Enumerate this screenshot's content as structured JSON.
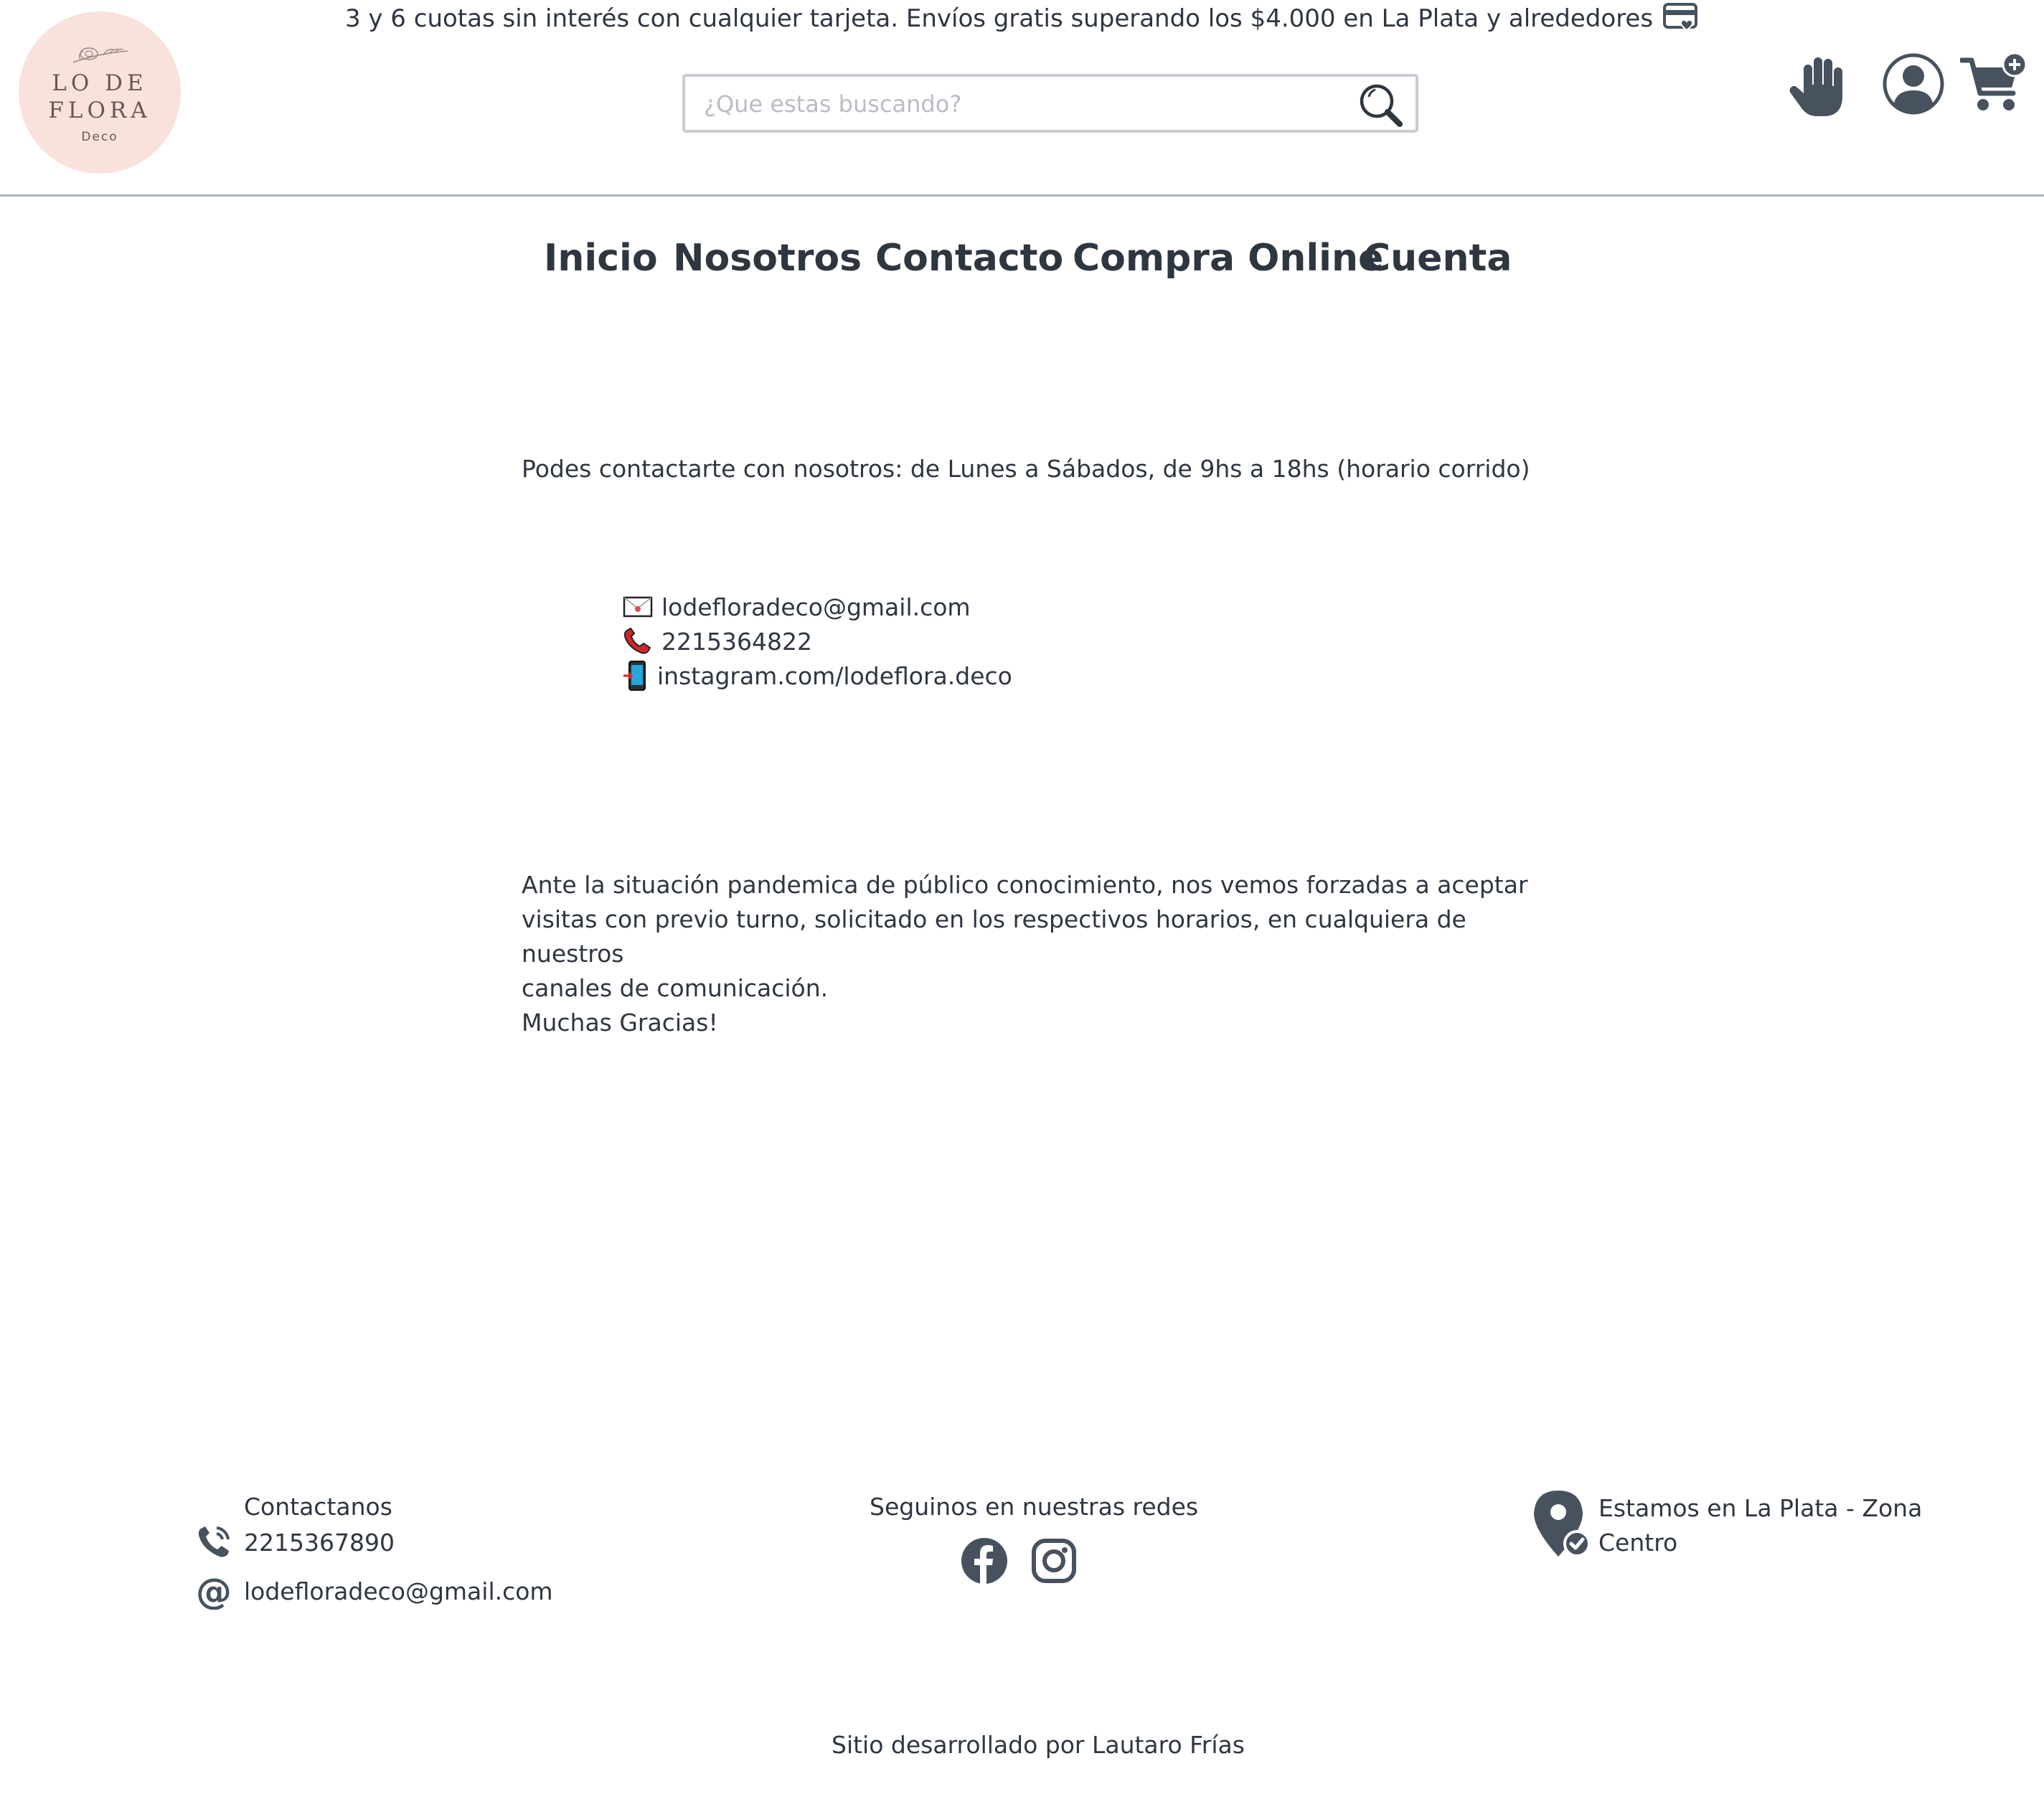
{
  "promo": {
    "text": "3 y 6 cuotas sin interés con cualquier tarjeta. Envíos gratis superando los $4.000 en La Plata y alrededores",
    "icon": "credit-card-heart-icon"
  },
  "logo": {
    "line1": "LO DE",
    "line2": "FLORA",
    "line3": "Deco",
    "background": "#f9e2dc"
  },
  "search": {
    "placeholder": "¿Que estas buscando?",
    "value": "",
    "icon": "search-icon"
  },
  "header_icons": [
    "hand-icon",
    "user-icon",
    "cart-add-icon"
  ],
  "nav": {
    "items": [
      "Inicio",
      "Nosotros",
      "Contacto",
      "Compra Online",
      "Cuenta"
    ]
  },
  "main": {
    "hours": "Podes contactarte con nosotros: de Lunes a Sábados, de 9hs a 18hs (horario corrido)",
    "contacts": [
      {
        "icon": "envelope-icon",
        "text": "lodefloradeco@gmail.com"
      },
      {
        "icon": "telephone-icon",
        "text": "2215364822"
      },
      {
        "icon": "mobile-phone-icon",
        "text": "instagram.com/lodeflora.deco"
      }
    ],
    "notice_lines": [
      "Ante la situación pandemica de público conocimiento, nos vemos forzadas a aceptar",
      "visitas con previo turno, solicitado en los respectivos horarios, en cualquiera de nuestros",
      "canales de comunicación.",
      "Muchas Gracias!"
    ]
  },
  "footer": {
    "contact_title": "Contactanos",
    "phone": "2215367890",
    "email": "lodefloradeco@gmail.com",
    "social_title": "Seguinos en nuestras redes",
    "social_icons": [
      "facebook-icon",
      "instagram-icon"
    ],
    "location_lines": [
      "Estamos en La Plata - Zona",
      "Centro"
    ],
    "credit": "Sitio desarrollado por Lautaro Frías"
  },
  "colors": {
    "text": "#2e3640",
    "icon": "#47525e",
    "rule": "#a8b1bd",
    "logo_bg": "#f9e2dc"
  }
}
